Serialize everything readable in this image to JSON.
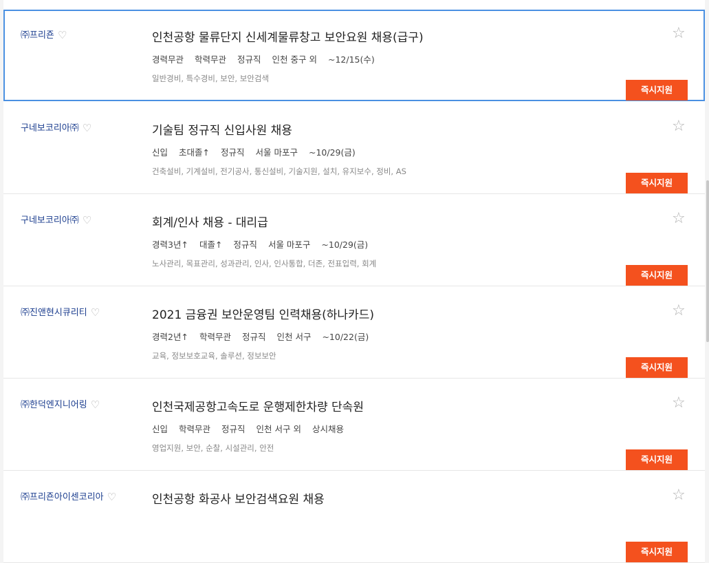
{
  "listings": [
    {
      "company": "㈜프리죤",
      "title": "인천공항 물류단지 신세계물류창고 보안요원 채용(급구)",
      "conditions": [
        "경력무관",
        "학력무관",
        "정규직",
        "인천 중구 외",
        "~12/15(수)"
      ],
      "tags": "일반경비, 특수경비, 보안, 보안검색",
      "apply_label": "즉시지원"
    },
    {
      "company": "구네보코리아㈜",
      "title": "기술팀 정규직 신입사원 채용",
      "conditions": [
        "신입",
        "초대졸↑",
        "정규직",
        "서울 마포구",
        "~10/29(금)"
      ],
      "tags": "건축설비, 기계설비, 전기공사, 통신설비, 기술지원, 설치, 유지보수, 정비, AS",
      "apply_label": "즉시지원"
    },
    {
      "company": "구네보코리아㈜",
      "title": "회계/인사 채용 - 대리급",
      "conditions": [
        "경력3년↑",
        "대졸↑",
        "정규직",
        "서울 마포구",
        "~10/29(금)"
      ],
      "tags": "노사관리, 목표관리, 성과관리, 인사, 인사통합, 더존, 전표입력, 회계",
      "apply_label": "즉시지원"
    },
    {
      "company": "㈜진앤현시큐리티",
      "title": "2021 금융권 보안운영팀 인력채용(하나카드)",
      "conditions": [
        "경력2년↑",
        "학력무관",
        "정규직",
        "인천 서구",
        "~10/22(금)"
      ],
      "tags": "교육, 정보보호교육, 솔루션, 정보보안",
      "apply_label": "즉시지원"
    },
    {
      "company": "㈜한덕엔지니어링",
      "title": "인천국제공항고속도로 운행제한차량 단속원",
      "conditions": [
        "신입",
        "학력무관",
        "정규직",
        "인천 서구 외",
        "상시채용"
      ],
      "tags": "영업지원, 보안, 순찰, 시설관리, 안전",
      "apply_label": "즉시지원"
    },
    {
      "company": "㈜프리죤아이센코리아",
      "title": "인천공항 화공사 보안검색요원 채용",
      "conditions": [],
      "tags": "",
      "apply_label": "즉시지원"
    }
  ],
  "icons": {
    "heart": "♡",
    "star": "☆"
  },
  "colors": {
    "company_link": "#1c3e8f",
    "apply_button": "#f4511e",
    "selected_border": "#4a90e2"
  }
}
